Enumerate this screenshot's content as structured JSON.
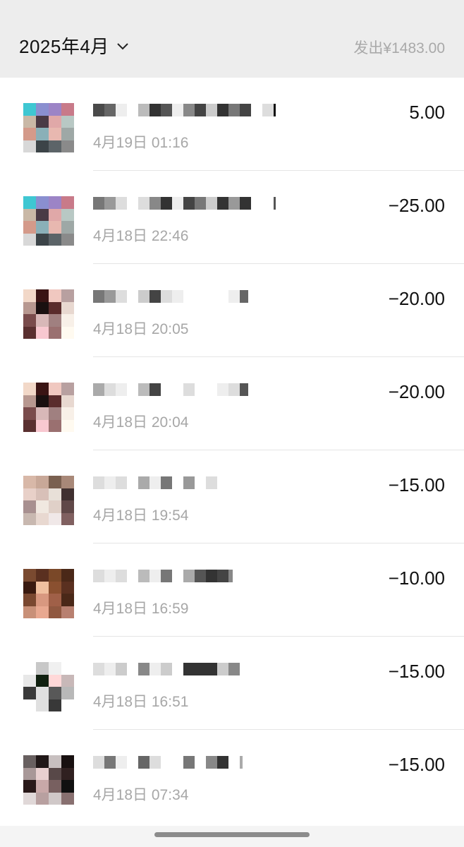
{
  "header": {
    "month_label": "2025年4月",
    "total_label": "发出¥1483.00"
  },
  "items": [
    {
      "date": "4月19日 01:16",
      "amount": "5.00"
    },
    {
      "date": "4月18日 22:46",
      "amount": "−25.00"
    },
    {
      "date": "4月18日 20:05",
      "amount": "−20.00"
    },
    {
      "date": "4月18日 20:04",
      "amount": "−20.00"
    },
    {
      "date": "4月18日 19:54",
      "amount": "−15.00"
    },
    {
      "date": "4月18日 16:59",
      "amount": "−10.00"
    },
    {
      "date": "4月18日 16:51",
      "amount": "−15.00"
    },
    {
      "date": "4月18日 07:34",
      "amount": "−15.00"
    }
  ],
  "icons": {
    "month_dropdown": "chevron-down-icon"
  }
}
